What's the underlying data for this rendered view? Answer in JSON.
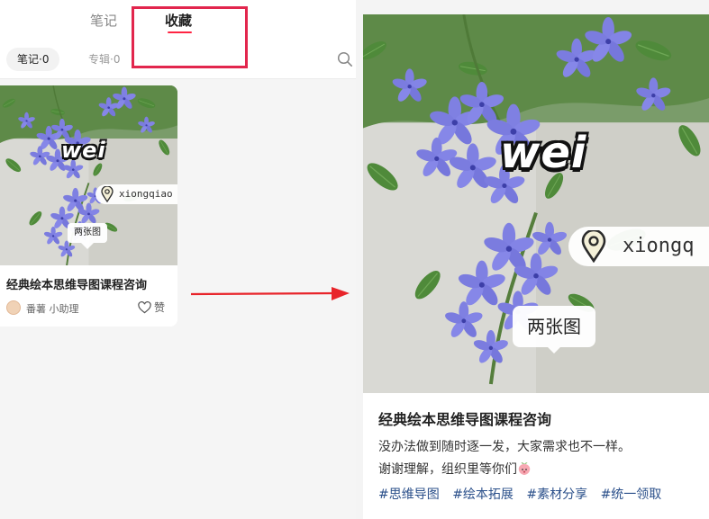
{
  "tabs": {
    "notes": "笔记",
    "favorites": "收藏"
  },
  "subtabs": {
    "notes": "笔记·0",
    "albums": "专辑·0"
  },
  "card": {
    "photo_text": "wei",
    "location": "xiongqiao",
    "image_count": "两张图",
    "title": "经典绘本思维导图课程咨询",
    "author": "番薯 小助理",
    "like_label": "赞"
  },
  "detail": {
    "photo_text": "wei",
    "location": "xiongq",
    "image_count": "两张图",
    "title": "经典绘本思维导图课程咨询",
    "body_line1": "没办法做到随时逐一发，大家需求也不一样。",
    "body_line2": "谢谢理解，组织里等你们",
    "emoji": "peach-face-emoji",
    "tags": [
      "#思维导图",
      "#绘本拓展",
      "#素材分享",
      "#统一领取"
    ]
  },
  "colors": {
    "accent": "#ff2442",
    "highlight_box": "#e2264d",
    "arrow": "#e8242a",
    "tag": "#2a4f8a",
    "flower": "#7d7fe0"
  },
  "icons": [
    "search-icon",
    "heart-icon",
    "location-pin-icon",
    "arrow-right-icon",
    "peach-face-emoji"
  ]
}
